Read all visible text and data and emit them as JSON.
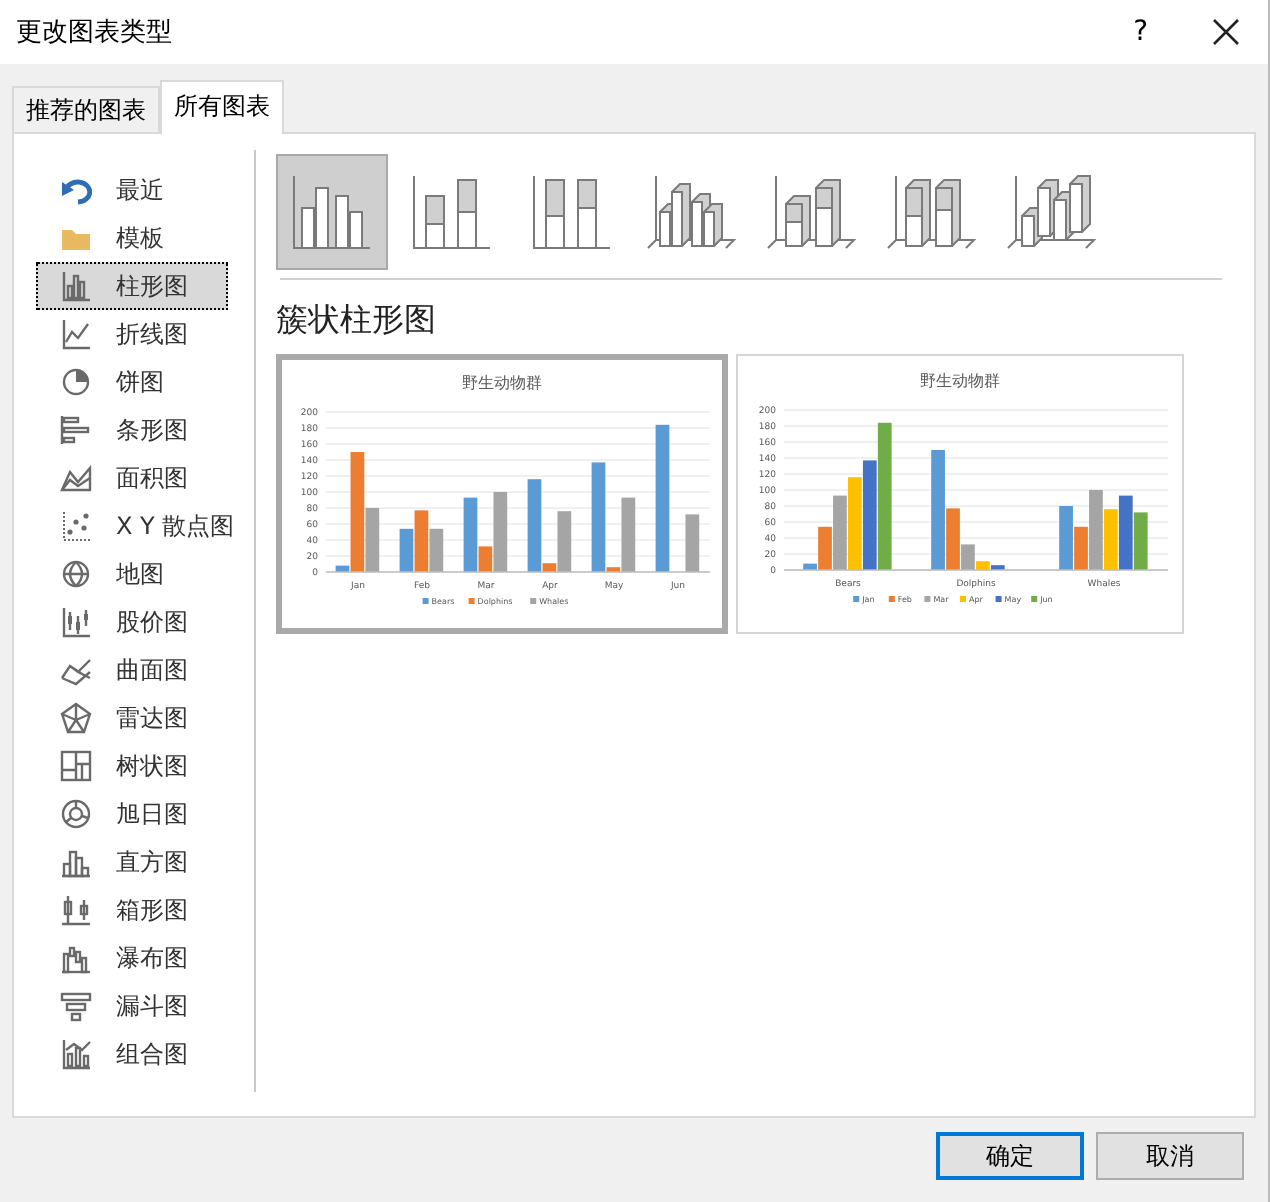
{
  "window": {
    "title": "更改图表类型",
    "help": "?"
  },
  "tabs": [
    {
      "label": "推荐的图表",
      "selected": false
    },
    {
      "label": "所有图表",
      "selected": true
    }
  ],
  "chart_types": [
    {
      "label": "最近",
      "selected": false
    },
    {
      "label": "模板",
      "selected": false
    },
    {
      "label": "柱形图",
      "selected": true
    },
    {
      "label": "折线图",
      "selected": false
    },
    {
      "label": "饼图",
      "selected": false
    },
    {
      "label": "条形图",
      "selected": false
    },
    {
      "label": "面积图",
      "selected": false
    },
    {
      "label": "X Y 散点图",
      "selected": false
    },
    {
      "label": "地图",
      "selected": false
    },
    {
      "label": "股价图",
      "selected": false
    },
    {
      "label": "曲面图",
      "selected": false
    },
    {
      "label": "雷达图",
      "selected": false
    },
    {
      "label": "树状图",
      "selected": false
    },
    {
      "label": "旭日图",
      "selected": false
    },
    {
      "label": "直方图",
      "selected": false
    },
    {
      "label": "箱形图",
      "selected": false
    },
    {
      "label": "瀑布图",
      "selected": false
    },
    {
      "label": "漏斗图",
      "selected": false
    },
    {
      "label": "组合图",
      "selected": false
    }
  ],
  "subtypes": [
    {
      "selected": true
    },
    {
      "selected": false
    },
    {
      "selected": false
    },
    {
      "selected": false
    },
    {
      "selected": false
    },
    {
      "selected": false
    },
    {
      "selected": false
    }
  ],
  "subtype_title": "簇状柱形图",
  "previews": [
    {
      "selected": true,
      "chart_data": {
        "type": "bar",
        "title": "野生动物群",
        "grid": true,
        "legend": "bottom",
        "categories": [
          "Jan",
          "Feb",
          "Mar",
          "Apr",
          "May",
          "Jun"
        ],
        "ylim": [
          0,
          200
        ],
        "yticks": [
          0,
          20,
          40,
          60,
          80,
          100,
          120,
          140,
          160,
          180,
          200
        ],
        "series": [
          {
            "name": "Bears",
            "color": "#5b9bd5",
            "values": [
              8,
              54,
              93,
              116,
              137,
              184
            ]
          },
          {
            "name": "Dolphins",
            "color": "#ed7d31",
            "values": [
              150,
              77,
              32,
              11,
              6,
              0
            ]
          },
          {
            "name": "Whales",
            "color": "#a5a5a5",
            "values": [
              80,
              54,
              100,
              76,
              93,
              72
            ]
          }
        ]
      }
    },
    {
      "selected": false,
      "chart_data": {
        "type": "bar",
        "title": "野生动物群",
        "grid": true,
        "legend": "bottom",
        "categories": [
          "Bears",
          "Dolphins",
          "Whales"
        ],
        "ylim": [
          0,
          200
        ],
        "yticks": [
          0,
          20,
          40,
          60,
          80,
          100,
          120,
          140,
          160,
          180,
          200
        ],
        "series": [
          {
            "name": "Jan",
            "color": "#5b9bd5",
            "values": [
              8,
              150,
              80
            ]
          },
          {
            "name": "Feb",
            "color": "#ed7d31",
            "values": [
              54,
              77,
              54
            ]
          },
          {
            "name": "Mar",
            "color": "#a5a5a5",
            "values": [
              93,
              32,
              100
            ]
          },
          {
            "name": "Apr",
            "color": "#ffc000",
            "values": [
              116,
              11,
              76
            ]
          },
          {
            "name": "May",
            "color": "#4472c4",
            "values": [
              137,
              6,
              93
            ]
          },
          {
            "name": "Jun",
            "color": "#70ad47",
            "values": [
              184,
              0,
              72
            ]
          }
        ]
      }
    }
  ],
  "buttons": [
    {
      "label": "确定",
      "kind": "primary"
    },
    {
      "label": "取消",
      "kind": "normal"
    }
  ]
}
